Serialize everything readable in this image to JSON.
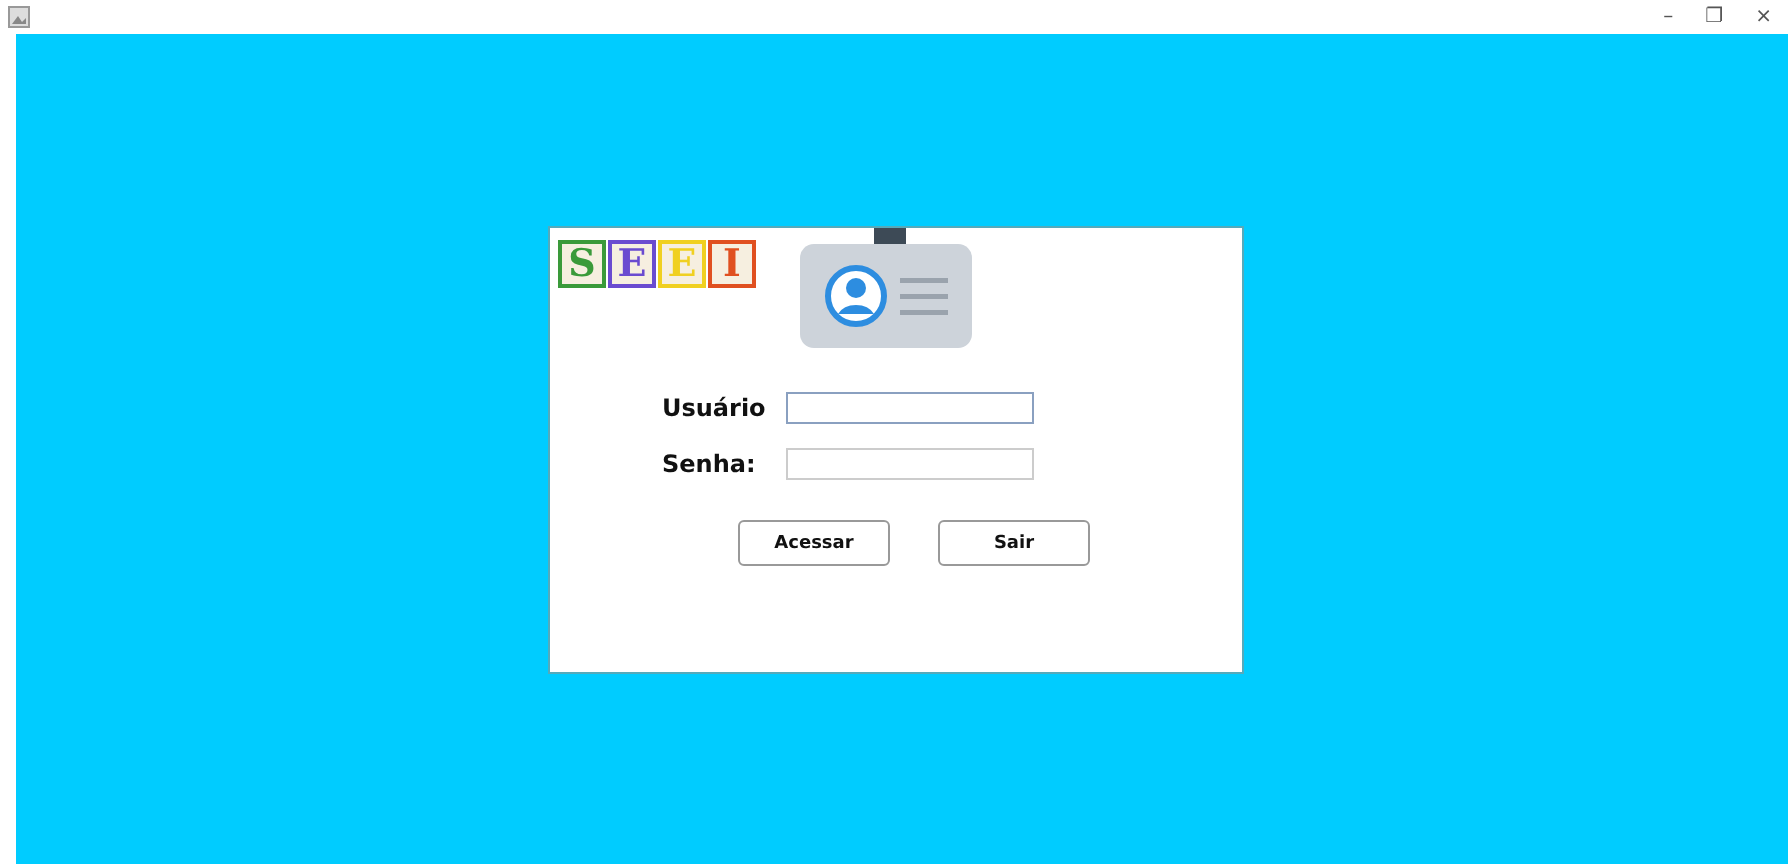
{
  "window": {
    "controls": [
      "–",
      "❐",
      "×"
    ]
  },
  "logo": {
    "blocks": [
      {
        "letter": "S",
        "color": "#3a9a3a"
      },
      {
        "letter": "E",
        "color": "#6a4bd0"
      },
      {
        "letter": "E",
        "color": "#f0d020"
      },
      {
        "letter": "I",
        "color": "#e05020"
      }
    ]
  },
  "form": {
    "fields": [
      {
        "label": "Usuário",
        "focused": true
      },
      {
        "label": "Senha:",
        "focused": false
      }
    ],
    "buttons": [
      "Acessar",
      "Sair"
    ]
  }
}
